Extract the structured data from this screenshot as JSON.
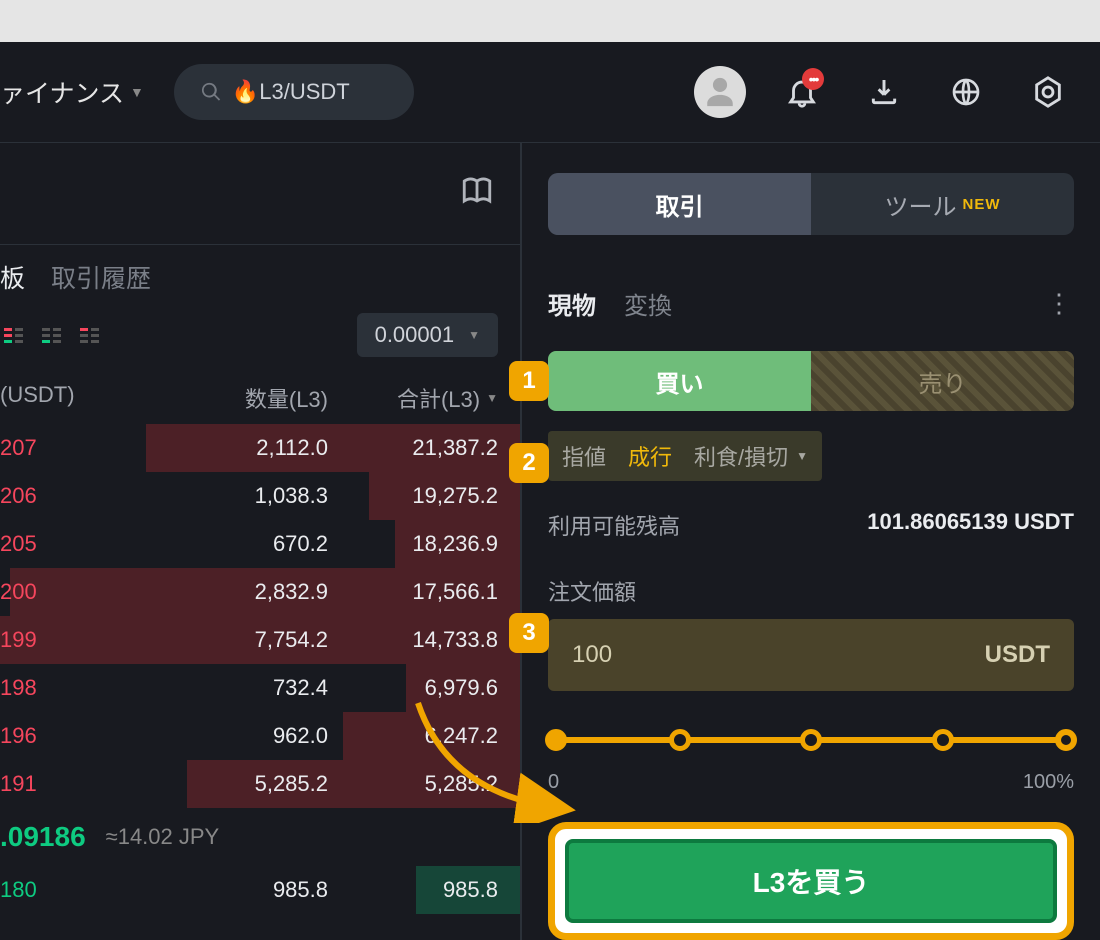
{
  "header": {
    "nav_label": "ァイナンス",
    "search_text": "🔥L3/USDT",
    "notification_badge": "•••"
  },
  "left": {
    "tabs": {
      "board": "板",
      "history": "取引履歴"
    },
    "depth_precision": "0.00001",
    "columns": {
      "price": "(USDT)",
      "qty": "数量(L3)",
      "total": "合計(L3)"
    },
    "asks": [
      {
        "price": "207",
        "qty": "2,112.0",
        "total": "21,387.2",
        "depth": 72
      },
      {
        "price": "206",
        "qty": "1,038.3",
        "total": "19,275.2",
        "depth": 29
      },
      {
        "price": "205",
        "qty": "670.2",
        "total": "18,236.9",
        "depth": 24
      },
      {
        "price": "200",
        "qty": "2,832.9",
        "total": "17,566.1",
        "depth": 98
      },
      {
        "price": "199",
        "qty": "7,754.2",
        "total": "14,733.8",
        "depth": 100
      },
      {
        "price": "198",
        "qty": "732.4",
        "total": "6,979.6",
        "depth": 22
      },
      {
        "price": "196",
        "qty": "962.0",
        "total": "6,247.2",
        "depth": 34
      },
      {
        "price": "191",
        "qty": "5,285.2",
        "total": "5,285.2",
        "depth": 64
      }
    ],
    "mid": {
      "price": ".09186",
      "approx": "≈14.02 JPY"
    },
    "bids": [
      {
        "price": "180",
        "qty": "985.8",
        "total": "985.8",
        "depth": 20
      }
    ]
  },
  "right": {
    "seg": {
      "trade": "取引",
      "tools": "ツール",
      "new": "NEW"
    },
    "modes": {
      "spot": "現物",
      "convert": "変換"
    },
    "bs": {
      "buy": "買い",
      "sell": "売り"
    },
    "ordertypes": {
      "limit": "指値",
      "market": "成行",
      "stop": "利食/損切"
    },
    "avail_label": "利用可能残高",
    "avail_value": "101.86065139 USDT",
    "amount_label": "注文価額",
    "amount_value": "100",
    "amount_unit": "USDT",
    "slider": {
      "min": "0",
      "max": "100%"
    },
    "buy_button": "L3を買う"
  },
  "steps": {
    "s1": "1",
    "s2": "2",
    "s3": "3"
  }
}
